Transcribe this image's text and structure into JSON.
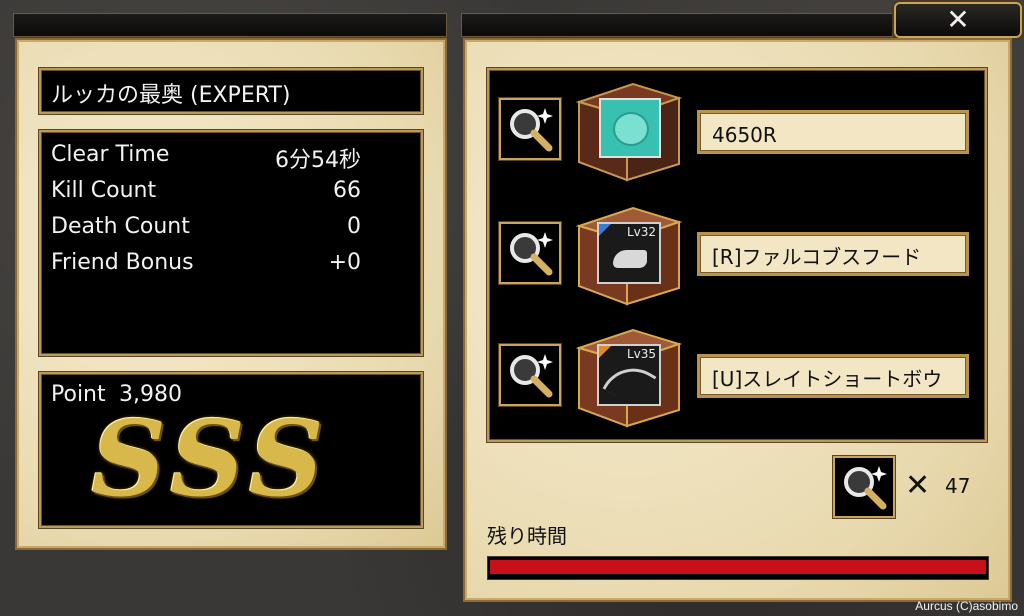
{
  "dungeon_title": "ルッカの最奥 (EXPERT)",
  "stats": [
    {
      "label": "Clear Time",
      "value": "6分54秒"
    },
    {
      "label": "Kill Count",
      "value": "66"
    },
    {
      "label": "Death Count",
      "value": "0"
    },
    {
      "label": "Friend Bonus",
      "value": "+0"
    }
  ],
  "point": {
    "label": "Point",
    "value": "3,980"
  },
  "rank": "SSS",
  "rewards": [
    {
      "name": "4650R",
      "icon": "coin-icon"
    },
    {
      "name": "[R]ファルコブスフード",
      "level": "Lv32",
      "icon": "hood-icon"
    },
    {
      "name": "[U]スレイトショートボウ",
      "level": "Lv35",
      "icon": "bow-icon"
    }
  ],
  "magnifier_multiplier": "✕",
  "magnifier_count": "47",
  "remaining_time_label": "残り時間",
  "remaining_time_fraction": 1.0,
  "close_label": "✕",
  "copyright": "Aurcus (C)asobimo",
  "colors": {
    "bar": "#c8101a",
    "gold": "#c8a45c"
  }
}
